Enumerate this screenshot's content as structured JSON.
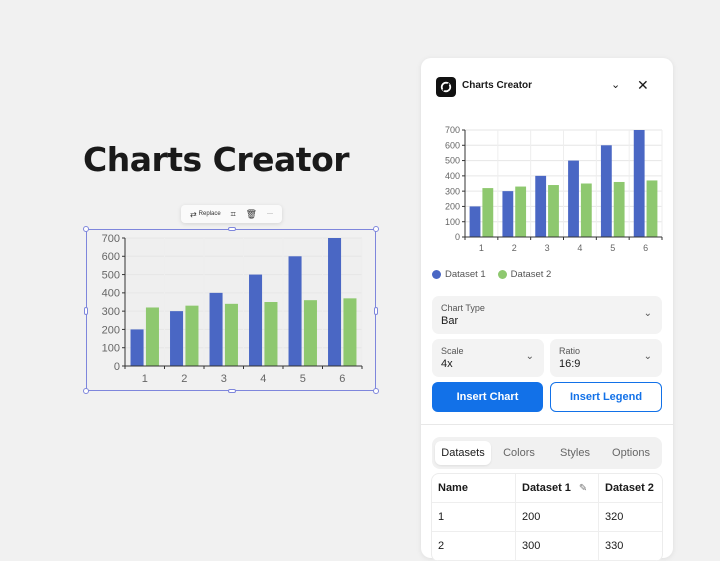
{
  "hero": {
    "title": "Charts Creator"
  },
  "toolbar": {
    "replace_label": "Replace",
    "more_label": "···"
  },
  "panel": {
    "title": "Charts Creator",
    "chart_type": {
      "label": "Chart Type",
      "value": "Bar"
    },
    "scale": {
      "label": "Scale",
      "value": "4x"
    },
    "ratio": {
      "label": "Ratio",
      "value": "16:9"
    },
    "insert_chart_label": "Insert Chart",
    "insert_legend_label": "Insert Legend",
    "tabs": [
      {
        "label": "Datasets",
        "active": true
      },
      {
        "label": "Colors"
      },
      {
        "label": "Styles"
      },
      {
        "label": "Options"
      }
    ],
    "table": {
      "headers": [
        "Name",
        "Dataset 1",
        "Dataset 2"
      ],
      "rows": [
        [
          "1",
          "200",
          "320"
        ],
        [
          "2",
          "300",
          "330"
        ]
      ]
    }
  },
  "colors": {
    "dataset1": "#4a67c4",
    "dataset2": "#8ec86f",
    "accent": "#1271e8"
  },
  "chart_data": {
    "type": "bar",
    "categories": [
      "1",
      "2",
      "3",
      "4",
      "5",
      "6"
    ],
    "series": [
      {
        "name": "Dataset 1",
        "values": [
          200,
          300,
          400,
          500,
          600,
          700
        ]
      },
      {
        "name": "Dataset 2",
        "values": [
          320,
          330,
          340,
          350,
          360,
          370
        ]
      }
    ],
    "yticks": [
      0,
      100,
      200,
      300,
      400,
      500,
      600,
      700
    ],
    "ylim": [
      0,
      700
    ],
    "title": "",
    "xlabel": "",
    "ylabel": "",
    "grid": true,
    "legend": "bottom-left"
  }
}
